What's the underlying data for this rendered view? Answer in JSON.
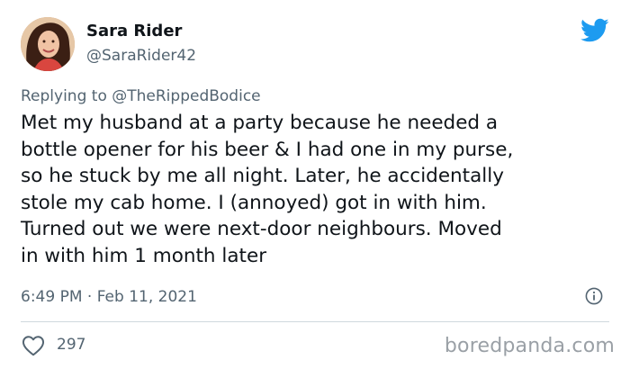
{
  "author": {
    "name": "Sara Rider",
    "handle": "@SaraRider42"
  },
  "reply": {
    "prefix": "Replying to ",
    "mention": "@TheRippedBodice"
  },
  "tweet": {
    "lines": [
      "Met my husband at a party because he needed a",
      "bottle opener for his beer & I had one in my purse,",
      "so he stuck by me all night. Later, he accidentally",
      "stole my cab home. I (annoyed) got in with him.",
      "Turned out we were next-door neighbours. Moved",
      "in with him 1 month later"
    ]
  },
  "meta": {
    "timestamp": "6:49 PM · Feb 11, 2021"
  },
  "actions": {
    "like_count": "297"
  },
  "watermark": "boredpanda.com",
  "colors": {
    "twitter_blue": "#1d9bf0",
    "secondary_text": "#536471",
    "divider": "#cfd9de"
  },
  "icons": {
    "brand": "twitter-bird-icon",
    "info": "info-icon",
    "like": "heart-icon"
  }
}
